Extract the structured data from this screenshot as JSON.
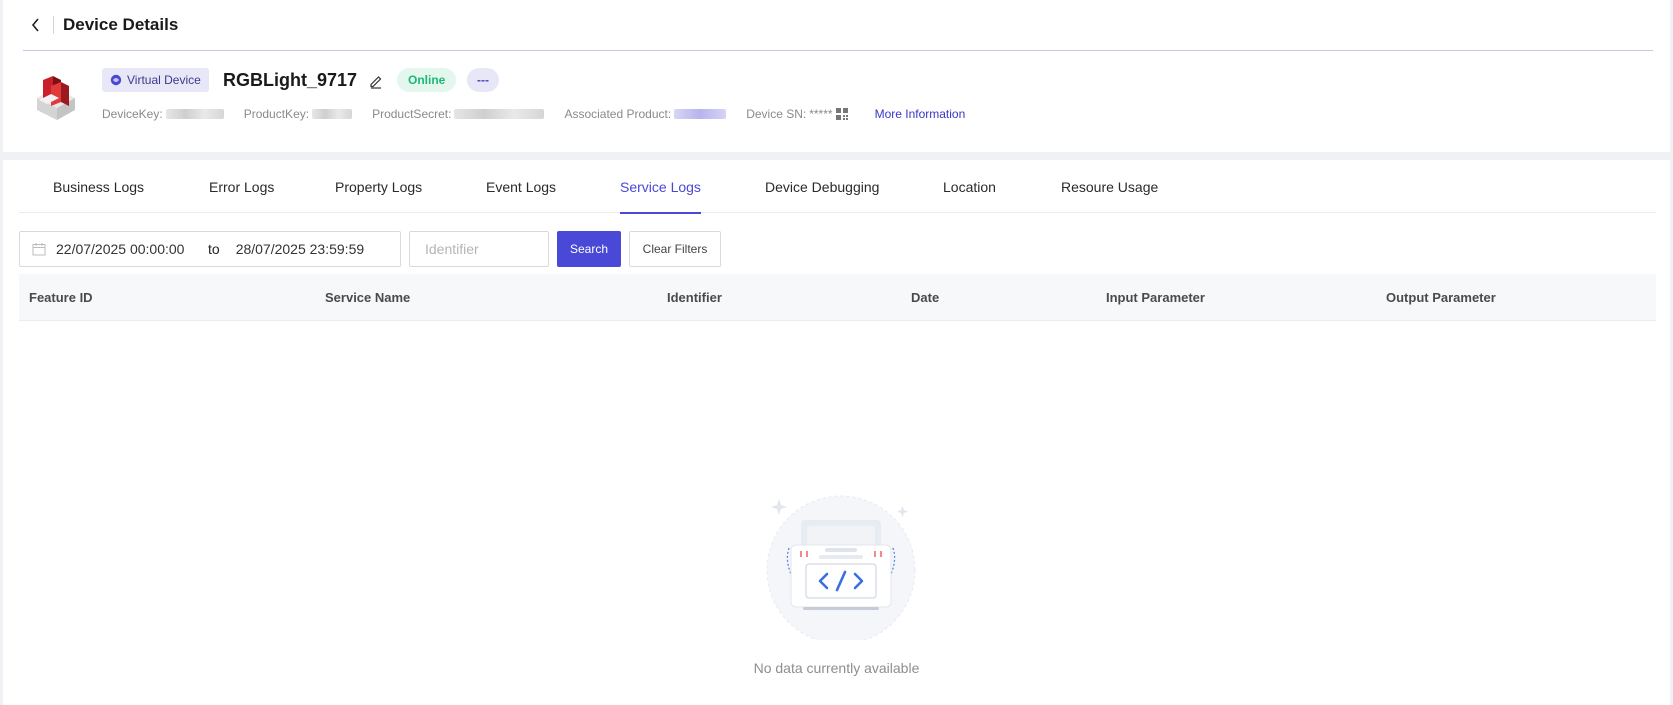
{
  "header": {
    "title": "Device Details"
  },
  "device": {
    "tag": "Virtual Device",
    "name": "RGBLight_9717",
    "status": "Online",
    "more_label": "---",
    "meta": {
      "device_key_label": "DeviceKey:",
      "product_key_label": "ProductKey:",
      "product_secret_label": "ProductSecret:",
      "associated_product_label": "Associated Product:",
      "device_sn_label": "Device SN:",
      "device_sn_value": "*****",
      "more_info": "More Information"
    }
  },
  "tabs": [
    {
      "label": "Business Logs"
    },
    {
      "label": "Error Logs"
    },
    {
      "label": "Property Logs"
    },
    {
      "label": "Event Logs"
    },
    {
      "label": "Service Logs"
    },
    {
      "label": "Device Debugging"
    },
    {
      "label": "Location"
    },
    {
      "label": "Resoure Usage"
    }
  ],
  "filters": {
    "date_from": "22/07/2025 00:00:00",
    "date_sep": "to",
    "date_to": "28/07/2025 23:59:59",
    "identifier_placeholder": "Identifier",
    "search_label": "Search",
    "clear_label": "Clear Filters"
  },
  "table": {
    "columns": [
      "Feature ID",
      "Service Name",
      "Identifier",
      "Date",
      "Input Parameter",
      "Output Parameter"
    ]
  },
  "empty": {
    "message": "No data currently available"
  },
  "colors": {
    "accent": "#4a48d6",
    "online": "#1fb873"
  }
}
